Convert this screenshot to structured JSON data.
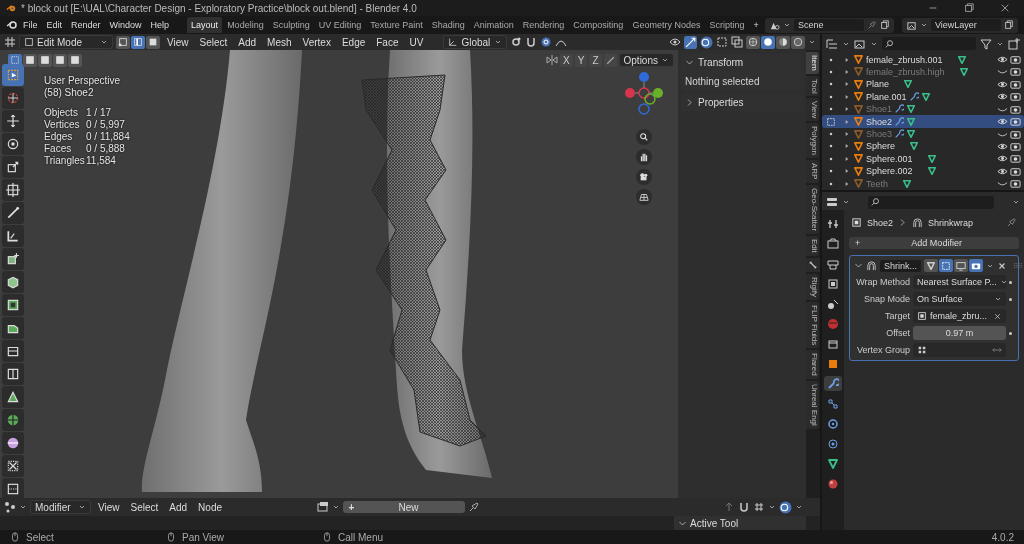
{
  "window": {
    "title": "* block out [E:\\UAL\\Character Design - Exploratory Practice\\block out.blend] - Blender 4.0"
  },
  "menu": [
    "File",
    "Edit",
    "Render",
    "Window",
    "Help"
  ],
  "workspaces": [
    {
      "label": "Layout",
      "selected": true
    },
    {
      "label": "Modeling",
      "selected": false
    },
    {
      "label": "Sculpting",
      "selected": false
    },
    {
      "label": "UV Editing",
      "selected": false
    },
    {
      "label": "Texture Paint",
      "selected": false
    },
    {
      "label": "Shading",
      "selected": false
    },
    {
      "label": "Animation",
      "selected": false
    },
    {
      "label": "Rendering",
      "selected": false
    },
    {
      "label": "Compositing",
      "selected": false
    },
    {
      "label": "Geometry Nodes",
      "selected": false
    },
    {
      "label": "Scripting",
      "selected": false
    }
  ],
  "add_workspace": "+",
  "scene": "Scene",
  "view_layer": "ViewLayer",
  "viewport": {
    "mode": "Edit Mode",
    "select_modes": [
      {
        "selected": false
      },
      {
        "selected": true
      },
      {
        "selected": false
      }
    ],
    "menus": [
      "View",
      "Select",
      "Add",
      "Mesh",
      "Vertex",
      "Edge",
      "Face",
      "UV"
    ],
    "orientation": "Global",
    "shading": [
      {
        "selected": false
      },
      {
        "selected": true
      },
      {
        "selected": false
      },
      {
        "selected": false
      }
    ],
    "box_modes": [
      {
        "selected": true
      },
      {
        "selected": false
      },
      {
        "selected": false
      },
      {
        "selected": false
      },
      {
        "selected": false
      }
    ],
    "axes": [
      "X",
      "Y",
      "Z"
    ],
    "options": "Options",
    "overlay": {
      "view": "User Perspective",
      "object": "(58) Shoe2",
      "stats": [
        {
          "label": "Objects",
          "value": "1 / 17"
        },
        {
          "label": "Vertices",
          "value": "0 / 5,997"
        },
        {
          "label": "Edges",
          "value": "0 / 11,884"
        },
        {
          "label": "Faces",
          "value": "0 / 5,888"
        },
        {
          "label": "Triangles",
          "value": "11,584"
        }
      ]
    },
    "tools": [
      {
        "selected": true
      },
      {
        "selected": false
      },
      {
        "selected": false
      },
      {
        "selected": false
      },
      {
        "selected": false
      },
      {
        "selected": false
      },
      {
        "selected": false
      },
      {
        "selected": false
      },
      {
        "selected": false
      },
      {
        "selected": false
      },
      {
        "selected": false
      },
      {
        "selected": false
      },
      {
        "selected": false
      },
      {
        "selected": false
      },
      {
        "selected": false
      },
      {
        "selected": false
      },
      {
        "selected": false
      },
      {
        "selected": false
      },
      {
        "selected": false
      }
    ]
  },
  "sidebar": {
    "tabs": [
      {
        "kind": "text",
        "label": "Item",
        "selected": true
      },
      {
        "kind": "text",
        "label": "Tool",
        "selected": false
      },
      {
        "kind": "text",
        "label": "View",
        "selected": false
      },
      {
        "kind": "text",
        "label": "Polygon",
        "selected": false
      },
      {
        "kind": "text",
        "label": "ARP",
        "selected": false
      },
      {
        "kind": "text",
        "label": "Geo-Scatter",
        "selected": false
      },
      {
        "kind": "text",
        "label": "Edit",
        "selected": false
      },
      {
        "kind": "icon",
        "selected": false
      },
      {
        "kind": "text",
        "label": "Rigify",
        "selected": false
      },
      {
        "kind": "text",
        "label": "FLIP Fluids",
        "selected": false
      },
      {
        "kind": "text",
        "label": "Flared",
        "selected": false
      },
      {
        "kind": "text",
        "label": "Unreal Engi",
        "selected": false
      }
    ],
    "panels": [
      {
        "title": "Transform",
        "expanded": true,
        "text": "Nothing selected"
      },
      {
        "title": "Properties",
        "expanded": false
      }
    ]
  },
  "outliner": {
    "items": [
      {
        "name": "female_zbrush.001",
        "hidden": false,
        "modifier": false,
        "selected": false
      },
      {
        "name": "female_zbrush.high",
        "hidden": true,
        "modifier": false,
        "selected": false
      },
      {
        "name": "Plane",
        "hidden": false,
        "modifier": false,
        "selected": false
      },
      {
        "name": "Plane.001",
        "hidden": false,
        "modifier": true,
        "selected": false
      },
      {
        "name": "Shoe1",
        "hidden": true,
        "modifier": true,
        "selected": false
      },
      {
        "name": "Shoe2",
        "hidden": false,
        "modifier": true,
        "selected": true
      },
      {
        "name": "Shoe3",
        "hidden": true,
        "modifier": true,
        "selected": false
      },
      {
        "name": "Sphere",
        "hidden": false,
        "modifier": false,
        "selected": false
      },
      {
        "name": "Sphere.001",
        "hidden": false,
        "modifier": false,
        "selected": false
      },
      {
        "name": "Sphere.002",
        "hidden": false,
        "modifier": false,
        "selected": false
      },
      {
        "name": "Teeth",
        "hidden": true,
        "modifier": false,
        "selected": false
      }
    ]
  },
  "properties": {
    "tabs": [
      {
        "selected": false
      },
      {
        "selected": false
      },
      {
        "selected": false
      },
      {
        "selected": false
      },
      {
        "selected": false
      },
      {
        "selected": false
      },
      {
        "selected": false
      },
      {
        "selected": false
      },
      {
        "selected": true
      },
      {
        "selected": false
      },
      {
        "selected": false
      },
      {
        "selected": false
      },
      {
        "selected": false
      },
      {
        "selected": false
      }
    ],
    "breadcrumb": [
      "Shoe2",
      "Shrinkwrap"
    ],
    "add_modifier": "Add Modifier",
    "add_modifier_icon": "+",
    "modifier": {
      "name": "Shrink...",
      "expanded": true,
      "fields": [
        {
          "kind": "dropdown",
          "label": "Wrap Method",
          "value": "Nearest Surface P..."
        },
        {
          "kind": "dropdown",
          "label": "Snap Mode",
          "value": "On Surface"
        },
        {
          "kind": "object",
          "label": "Target",
          "value": "female_zbru..."
        },
        {
          "kind": "number",
          "label": "Offset",
          "value": "0.97 m"
        },
        {
          "kind": "group",
          "label": "Vertex Group"
        }
      ]
    }
  },
  "node_editor": {
    "type": "Modifier",
    "menus": [
      "View",
      "Select",
      "Add",
      "Node"
    ],
    "new": "New",
    "new_icon": "+",
    "panel": "Active Tool"
  },
  "status_bar": {
    "hints": [
      "Select",
      "Pan View",
      "Call Menu"
    ],
    "version": "4.0.2"
  }
}
